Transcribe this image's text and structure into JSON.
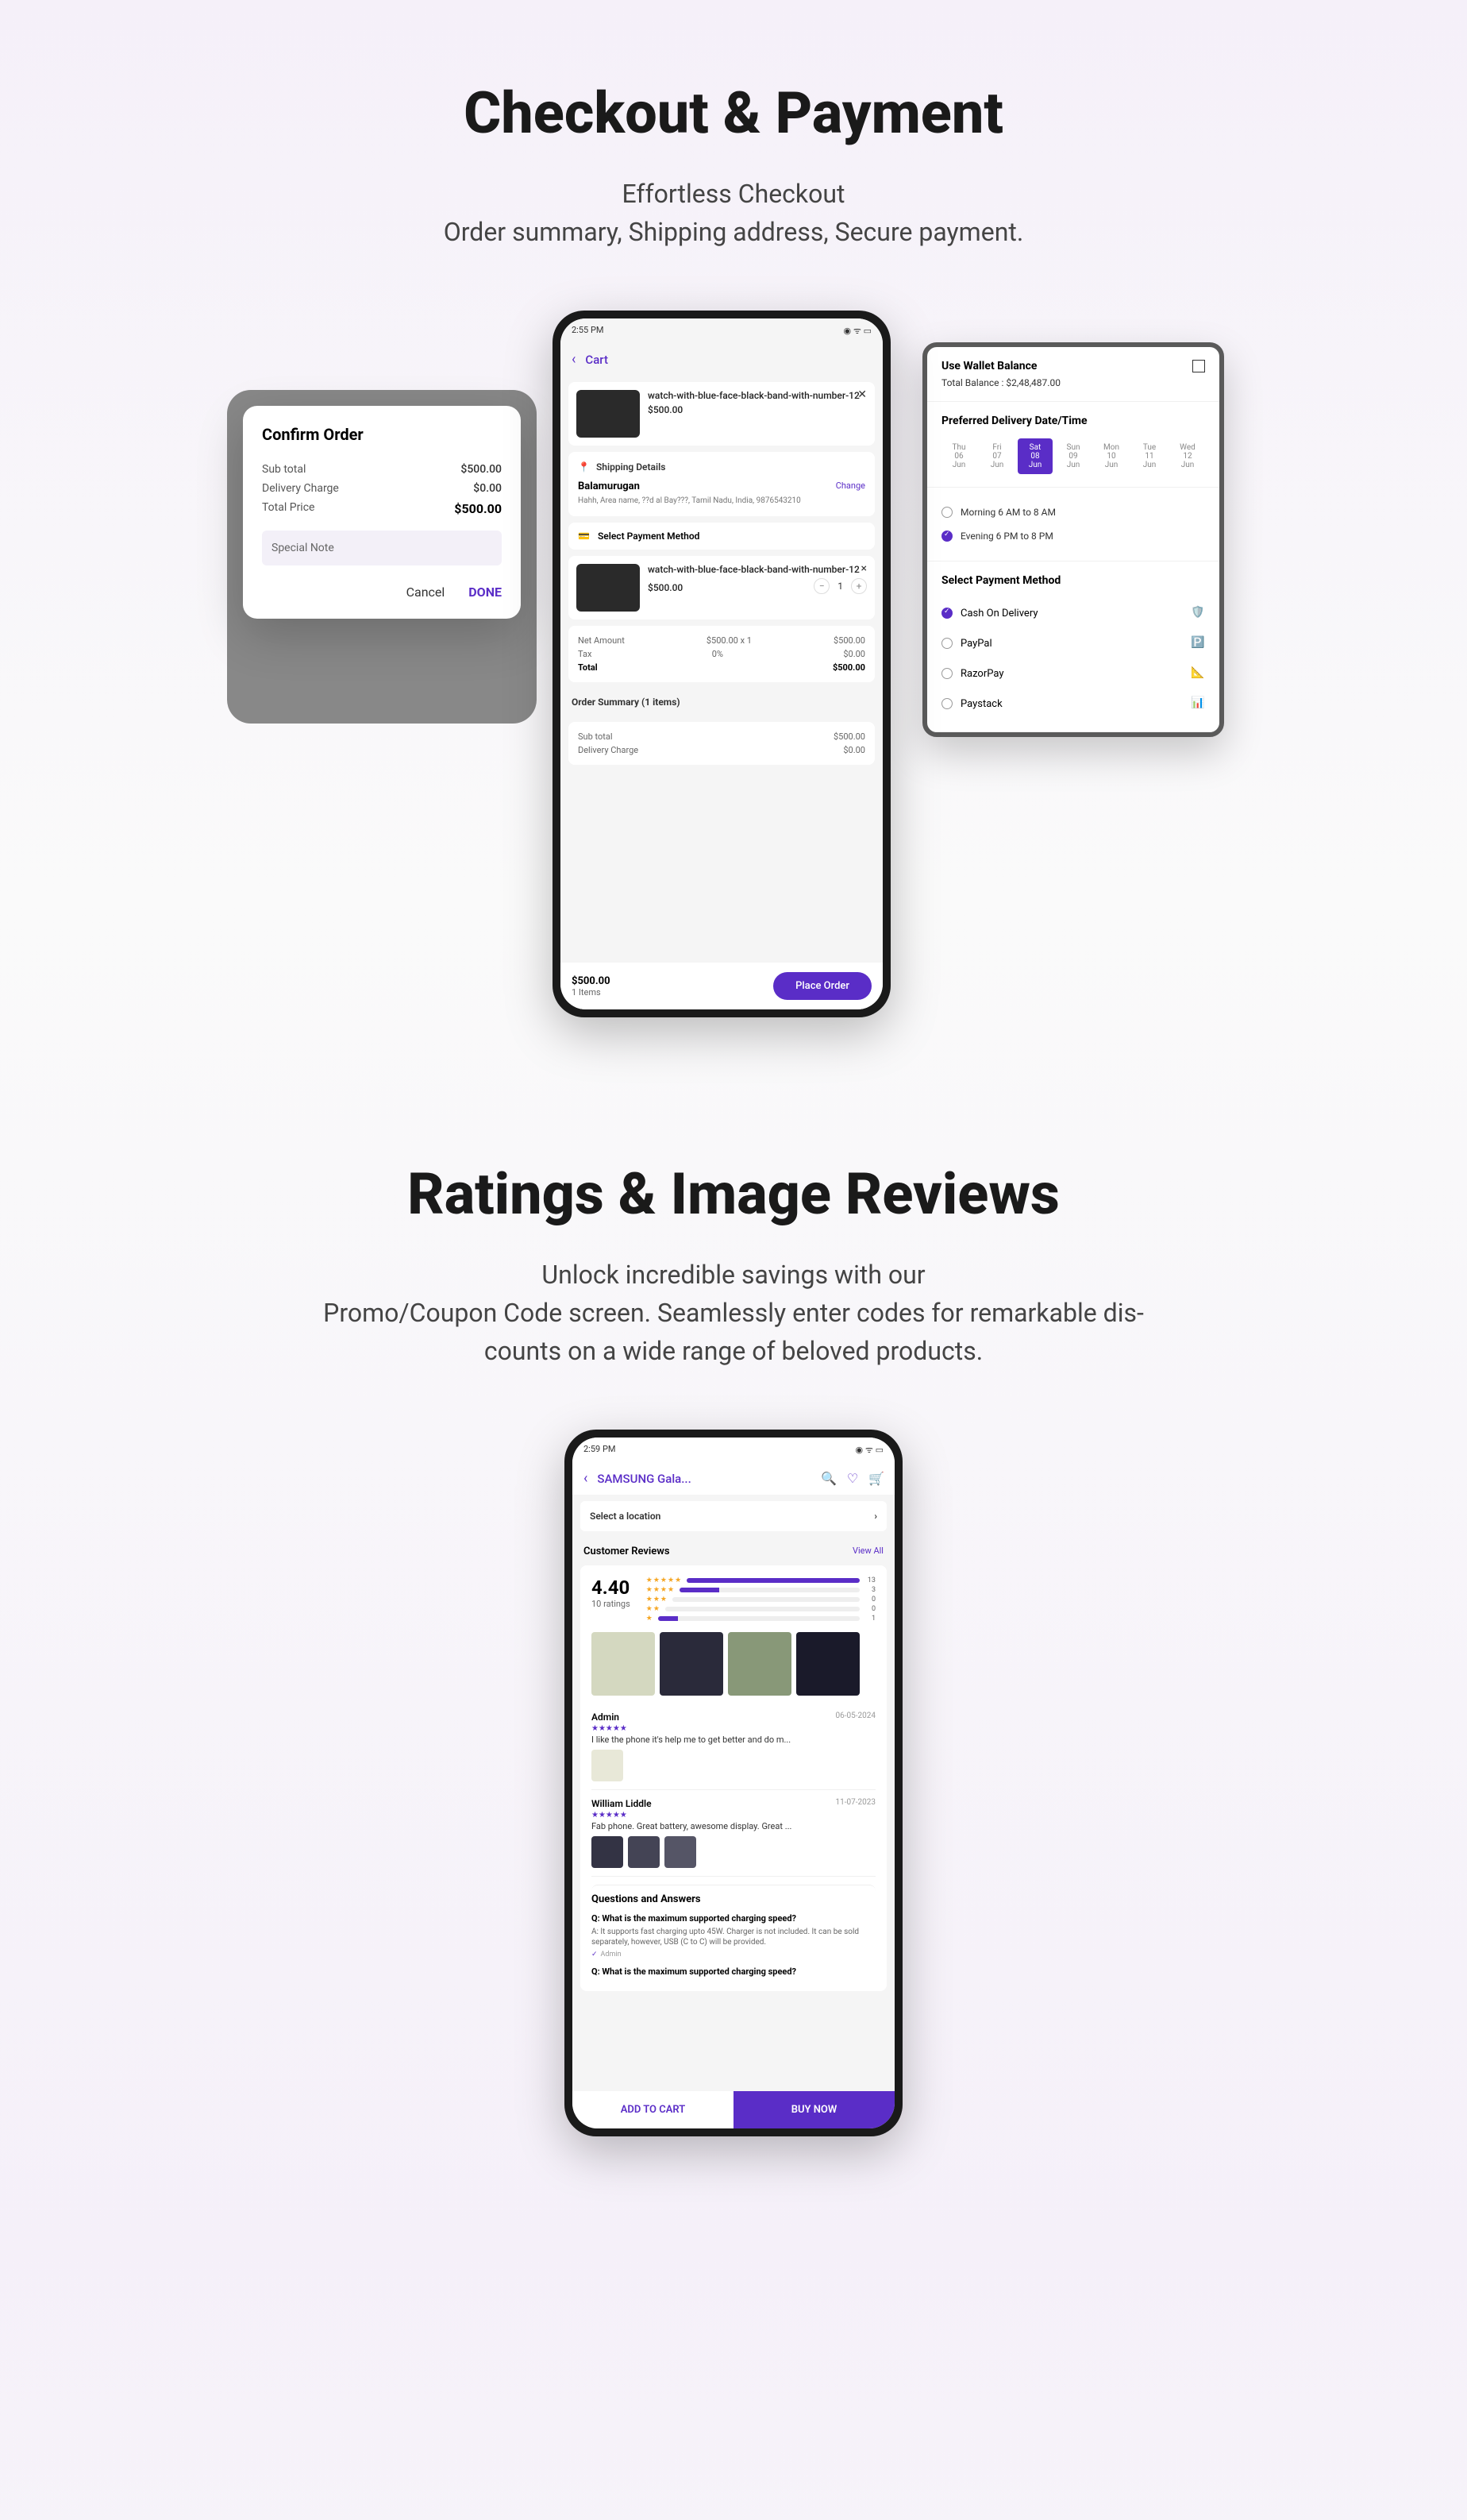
{
  "section1": {
    "title": "Checkout & Payment",
    "subtitle": "Effortless Checkout",
    "desc": "Order summary, Shipping address, Secure payment."
  },
  "confirm": {
    "id_bg": "6543210",
    "title": "Confirm Order",
    "subtotal_label": "Sub total",
    "subtotal": "$500.00",
    "delivery_label": "Delivery Charge",
    "delivery": "$0.00",
    "total_label": "Total Price",
    "total": "$500.00",
    "note": "Special Note",
    "cancel": "Cancel",
    "done": "DONE"
  },
  "cart": {
    "time": "2:55 PM",
    "title": "Cart",
    "prod_name": "watch-with-blue-face-black-band-with-number-12",
    "prod_price": "$500.00",
    "ship_title": "Shipping Details",
    "ship_name": "Balamurugan",
    "change": "Change",
    "ship_addr": "Hahh, Area name, ??d al Bay???, Tamil Nadu, India, 9876543210",
    "pay_title": "Select Payment Method",
    "net_label": "Net Amount",
    "net_mid": "$500.00 x 1",
    "net_val": "$500.00",
    "tax_label": "Tax",
    "tax_mid": "0%",
    "tax_val": "$0.00",
    "total_label": "Total",
    "total_val": "$500.00",
    "summary_head": "Order Summary (1 items)",
    "sub_label": "Sub total",
    "sub_val": "$500.00",
    "del_label": "Delivery Charge",
    "del_val": "$0.00",
    "footer_total": "$500.00",
    "footer_items": "1 Items",
    "place": "Place Order",
    "qty": "1"
  },
  "wallet": {
    "title": "Use Wallet Balance",
    "balance": "Total Balance : $2,48,487.00",
    "pref": "Preferred Delivery Date/Time",
    "days": [
      {
        "d": "Thu",
        "n": "06",
        "m": "Jun"
      },
      {
        "d": "Fri",
        "n": "07",
        "m": "Jun"
      },
      {
        "d": "Sat",
        "n": "08",
        "m": "Jun",
        "active": true
      },
      {
        "d": "Sun",
        "n": "09",
        "m": "Jun"
      },
      {
        "d": "Mon",
        "n": "10",
        "m": "Jun"
      },
      {
        "d": "Tue",
        "n": "11",
        "m": "Jun"
      },
      {
        "d": "Wed",
        "n": "12",
        "m": "Jun"
      }
    ],
    "slot1": "Morning 6 AM to 8 AM",
    "slot2": "Evening 6 PM to 8 PM",
    "pay_title": "Select Payment Method",
    "methods": [
      {
        "name": "Cash On Delivery",
        "on": true,
        "ico": "🛡️"
      },
      {
        "name": "PayPal",
        "on": false,
        "ico": "🅿️"
      },
      {
        "name": "RazorPay",
        "on": false,
        "ico": "📐"
      },
      {
        "name": "Paystack",
        "on": false,
        "ico": "📊"
      }
    ]
  },
  "section2": {
    "title": "Ratings & Image Reviews",
    "desc1": "Unlock incredible savings with our",
    "desc2": "Promo/Coupon Code screen. Seamlessly enter codes for remarkable dis-",
    "desc3": "counts on a wide range of beloved products."
  },
  "reviews": {
    "time": "2:59 PM",
    "title": "SAMSUNG Gala...",
    "loc": "Select a location",
    "head": "Customer Reviews",
    "viewall": "View All",
    "rating": "4.40",
    "count": "10  ratings",
    "bars": [
      {
        "w": 100,
        "c": "13"
      },
      {
        "w": 22,
        "c": "3"
      },
      {
        "w": 0,
        "c": "0"
      },
      {
        "w": 0,
        "c": "0"
      },
      {
        "w": 10,
        "c": "1"
      }
    ],
    "r1": {
      "name": "Admin",
      "date": "06-05-2024",
      "stars": "★★★★★",
      "text": "I like the phone it's help me to get better and do m..."
    },
    "r2": {
      "name": "William Liddle",
      "date": "11-07-2023",
      "stars": "★★★★★",
      "text": "Fab phone. Great battery, awesome display. Great ..."
    },
    "qa_title": "Questions and Answers",
    "q1": "Q: What is the maximum supported charging speed?",
    "a1": "A: It supports fast charging upto 45W. Charger is not included. It can be sold separately, however, USB (C to C) will be provided.",
    "by": "Admin",
    "q2": "Q: What is the maximum supported charging speed?",
    "add": "ADD TO CART",
    "buy": "BUY NOW"
  }
}
